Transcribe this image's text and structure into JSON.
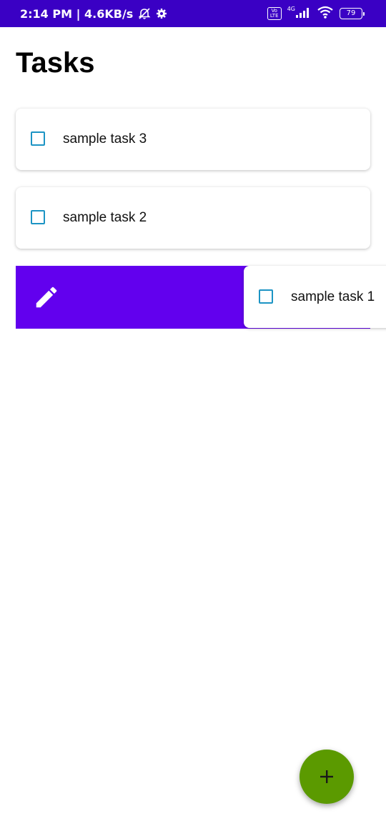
{
  "status_bar": {
    "time_speed": "2:14 PM | 4.6KB/s",
    "volte_label": "Vo LTE",
    "network_label": "4G",
    "battery_level": "79",
    "icons": [
      "alarm-off-icon",
      "settings-gear-icon",
      "volte-icon",
      "signal-icon",
      "wifi-icon",
      "battery-icon"
    ],
    "background_color": "#3a00c4"
  },
  "header": {
    "title": "Tasks"
  },
  "tasks": [
    {
      "label": "sample task 3",
      "checked": false
    },
    {
      "label": "sample task 2",
      "checked": false
    },
    {
      "label": "sample task 1",
      "checked": false
    }
  ],
  "swipe_action": {
    "icon": "edit-pencil-icon",
    "background_color": "#6200ee"
  },
  "fab": {
    "icon": "plus-icon",
    "background_color": "#5b9a00"
  },
  "colors": {
    "checkbox_border": "#1c94c4",
    "title_text": "#000000"
  }
}
